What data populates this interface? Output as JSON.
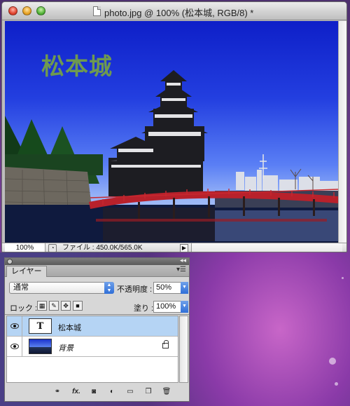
{
  "document": {
    "title": "photo.jpg @ 100% (松本城, RGB/8) *",
    "canvas_text": "松本城"
  },
  "status_bar": {
    "zoom": "100%",
    "file_info": "ファイル : 450.0K/565.0K"
  },
  "layers_panel": {
    "tab_label": "レイヤー",
    "blend_mode": "通常",
    "opacity_label": "不透明度 :",
    "opacity_value": "50%",
    "lock_label": "ロック :",
    "fill_label": "塗り :",
    "fill_value": "100%",
    "layers": [
      {
        "name": "松本城",
        "thumb_text": "T",
        "selected": true,
        "locked": false
      },
      {
        "name": "背景",
        "selected": false,
        "locked": true
      }
    ],
    "footer_fx": "fx."
  },
  "colors": {
    "sky_top": "#0e1fc8",
    "sky_bottom": "#b9cdf4",
    "canvas_text": "#6e9950",
    "bridge": "#b8212b",
    "selected_row": "#b5d4f4",
    "panel_bg": "#d7d7d7"
  },
  "icons": [
    "close-button",
    "minimize-button",
    "zoom-button",
    "document-icon",
    "eye-icon",
    "lock-transparent-icon",
    "lock-paint-icon",
    "lock-move-icon",
    "lock-all-icon",
    "link-icon",
    "fx-icon",
    "mask-icon",
    "adjustment-icon",
    "group-folder-icon",
    "new-layer-icon",
    "trash-icon",
    "panel-menu-icon"
  ]
}
